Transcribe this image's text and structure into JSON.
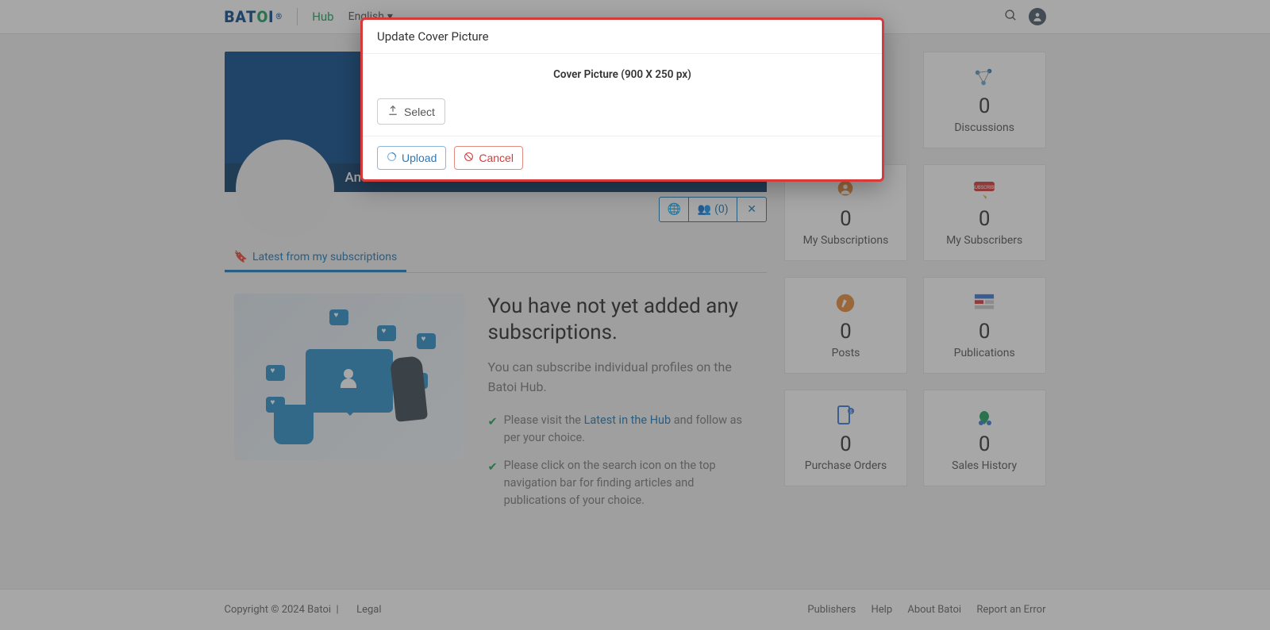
{
  "header": {
    "logo_text": "BATOI",
    "hub_label": "Hub",
    "language": "English"
  },
  "profile": {
    "name": "Amanda",
    "subscriber_count": "(0)"
  },
  "tabs": {
    "latest": "Latest from my subscriptions"
  },
  "empty_state": {
    "heading": "You have not yet added any subscriptions.",
    "sub": "You can subscribe individual profiles on the Batoi Hub.",
    "tip1_pre": "Please visit the ",
    "tip1_link": "Latest in the Hub",
    "tip1_post": " and follow as per your choice.",
    "tip2": "Please click on the search icon on the top navigation bar for finding articles and publications of your choice."
  },
  "cards": {
    "discussions": {
      "count": "0",
      "label": "Discussions"
    },
    "mysubs": {
      "count": "0",
      "label": "My Subscriptions"
    },
    "subscribers": {
      "count": "0",
      "label": "My Subscribers"
    },
    "posts": {
      "count": "0",
      "label": "Posts"
    },
    "publications": {
      "count": "0",
      "label": "Publications"
    },
    "orders": {
      "count": "0",
      "label": "Purchase Orders"
    },
    "sales": {
      "count": "0",
      "label": "Sales History"
    }
  },
  "footer": {
    "copyright": "Copyright © 2024 Batoi",
    "legal": "Legal",
    "links": {
      "publishers": "Publishers",
      "help": "Help",
      "about": "About Batoi",
      "report": "Report an Error"
    }
  },
  "modal": {
    "title": "Update Cover Picture",
    "hint": "Cover Picture (900 X 250 px)",
    "select": "Select",
    "upload": "Upload",
    "cancel": "Cancel"
  }
}
